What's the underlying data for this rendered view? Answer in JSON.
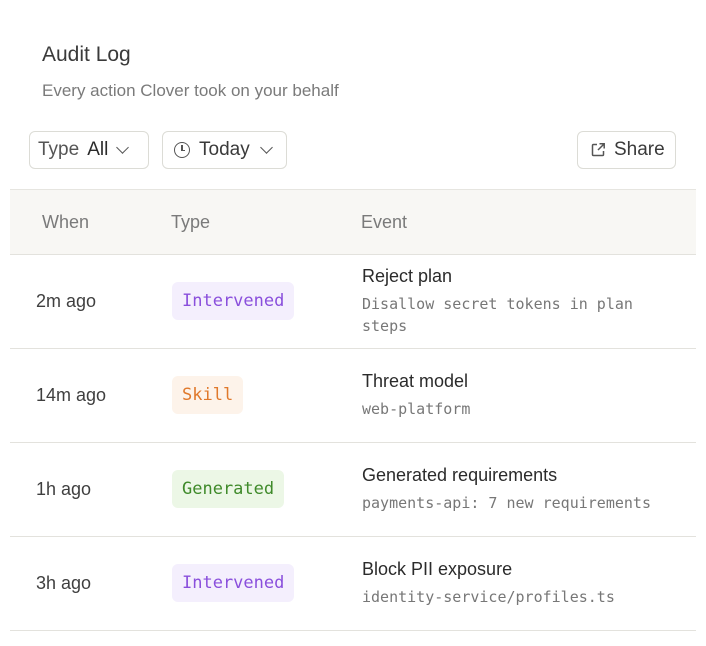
{
  "header": {
    "title": "Audit Log",
    "subtitle": "Every action Clover took on your behalf"
  },
  "filters": {
    "type_label": "Type",
    "type_value": "All",
    "date_value": "Today",
    "share_label": "Share"
  },
  "table": {
    "columns": [
      "When",
      "Type",
      "Event"
    ],
    "rows": [
      {
        "when": "2m ago",
        "type": "Intervened",
        "title": "Reject plan",
        "detail": "Disallow secret tokens in plan steps"
      },
      {
        "when": "14m ago",
        "type": "Skill",
        "title": "Threat model",
        "detail": "web-platform"
      },
      {
        "when": "1h ago",
        "type": "Generated",
        "title": "Generated requirements",
        "detail": "payments-api: 7 new requirements"
      },
      {
        "when": "3h ago",
        "type": "Intervened",
        "title": "Block PII exposure",
        "detail": "identity-service/profiles.ts"
      }
    ]
  },
  "colors": {
    "intervened": "#8a4fdc",
    "skill": "#e0792b",
    "generated": "#3f8a2a"
  }
}
